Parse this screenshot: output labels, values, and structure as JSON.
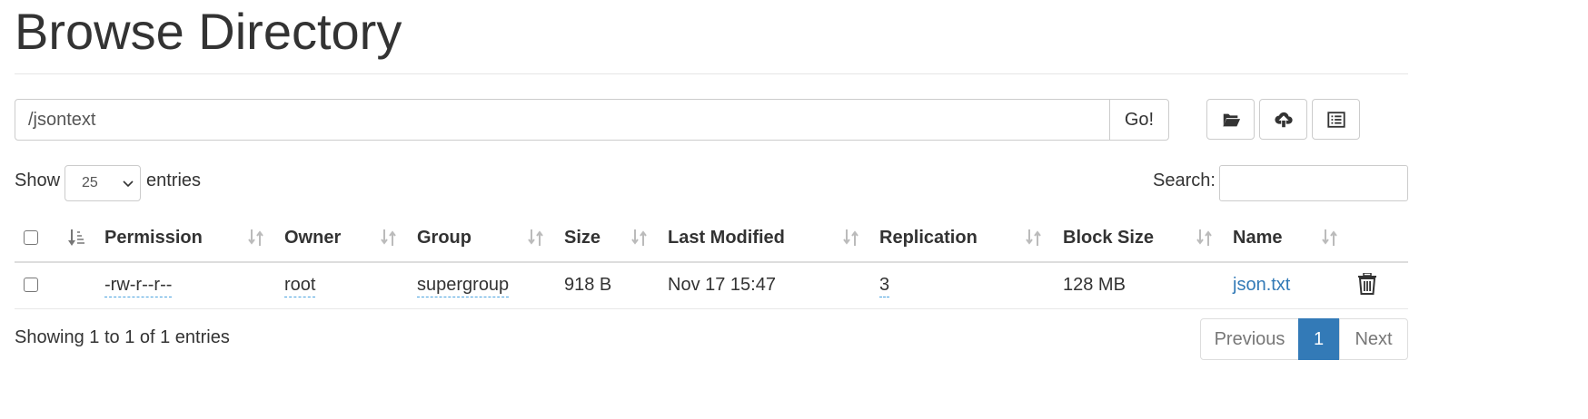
{
  "page": {
    "title": "Browse Directory"
  },
  "toolbar": {
    "path_value": "/jsontext",
    "go_label": "Go!",
    "buttons": [
      "folder-open-icon",
      "cloud-upload-icon",
      "list-alt-icon"
    ]
  },
  "length_menu": {
    "show_label": "Show",
    "selected": "25",
    "entries_label": "entries"
  },
  "search": {
    "label": "Search:",
    "value": ""
  },
  "table": {
    "columns": [
      "Permission",
      "Owner",
      "Group",
      "Size",
      "Last Modified",
      "Replication",
      "Block Size",
      "Name"
    ],
    "rows": [
      {
        "permission": "-rw-r--r--",
        "owner": "root",
        "group": "supergroup",
        "size": "918 B",
        "last_modified": "Nov 17 15:47",
        "replication": "3",
        "block_size": "128 MB",
        "name": "json.txt"
      }
    ]
  },
  "footer": {
    "info": "Showing 1 to 1 of 1 entries"
  },
  "pagination": {
    "previous": "Previous",
    "current_page": "1",
    "next": "Next"
  },
  "colors": {
    "link": "#337ab7",
    "active_page": "#337ab7",
    "dotted_underline": "#4aa3df"
  }
}
